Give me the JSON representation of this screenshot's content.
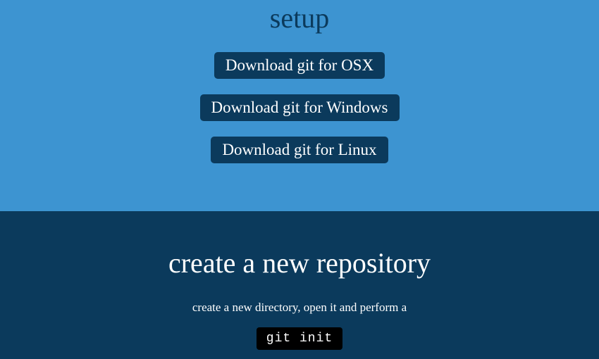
{
  "setup": {
    "title": "setup",
    "buttons": [
      {
        "label": "Download git for OSX"
      },
      {
        "label": "Download git for Windows"
      },
      {
        "label": "Download git for Linux"
      }
    ]
  },
  "create": {
    "title": "create a new repository",
    "instruction": "create a new directory, open it and perform a",
    "code": "git init"
  }
}
